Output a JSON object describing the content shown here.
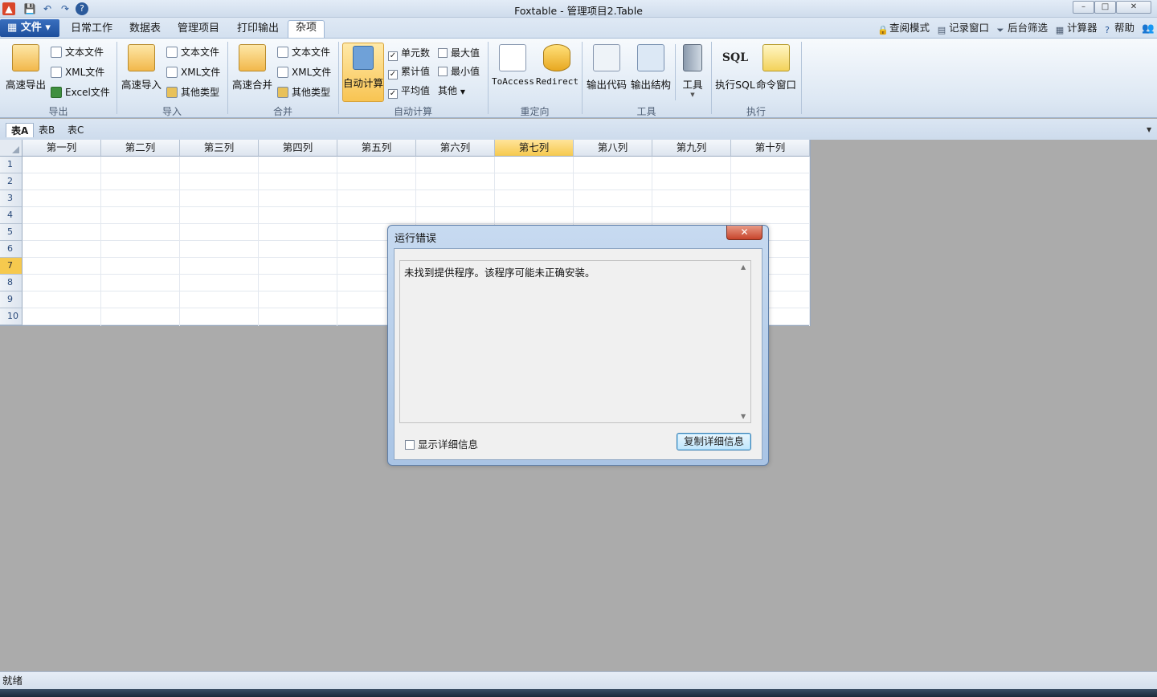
{
  "window": {
    "title": "Foxtable - 管理项目2.Table",
    "minimize": "–",
    "maximize": "□",
    "close": "✕"
  },
  "menu": {
    "file": "文件",
    "tabs": [
      "日常工作",
      "数据表",
      "管理项目",
      "打印输出",
      "杂项"
    ],
    "right_tools": [
      "查阅模式",
      "记录窗口",
      "后台筛选",
      "计算器",
      "帮助"
    ]
  },
  "ribbon": {
    "export": {
      "big": "高速导出",
      "small": [
        "文本文件",
        "XML文件",
        "Excel文件"
      ],
      "label": "导出"
    },
    "import": {
      "big": "高速导入",
      "small": [
        "文本文件",
        "XML文件",
        "其他类型"
      ],
      "label": "导入"
    },
    "merge": {
      "big": "高速合并",
      "small": [
        "文本文件",
        "XML文件",
        "其他类型"
      ],
      "label": "合并"
    },
    "autocalc": {
      "big": "自动计算",
      "checks": [
        {
          "label": "单元数",
          "checked": true
        },
        {
          "label": "最大值",
          "checked": false
        },
        {
          "label": "累计值",
          "checked": true
        },
        {
          "label": "最小值",
          "checked": false
        },
        {
          "label": "平均值",
          "checked": true
        }
      ],
      "other": "其他",
      "label": "自动计算"
    },
    "redirect": {
      "buttons": [
        "ToAccess",
        "Redirect"
      ],
      "label": "重定向"
    },
    "tools": {
      "buttons": [
        "输出代码",
        "输出结构",
        "工具"
      ],
      "label": "工具"
    },
    "execute": {
      "buttons": [
        "执行SQL",
        "命令窗口"
      ],
      "label": "执行"
    }
  },
  "sheets": [
    "表A",
    "表B",
    "表C"
  ],
  "grid": {
    "columns": [
      "第一列",
      "第二列",
      "第三列",
      "第四列",
      "第五列",
      "第六列",
      "第七列",
      "第八列",
      "第九列",
      "第十列"
    ],
    "rows": [
      "1",
      "2",
      "3",
      "4",
      "5",
      "6",
      "7",
      "8",
      "9",
      "10"
    ],
    "selected_column": "第七列",
    "selected_row": "7"
  },
  "dialog": {
    "title": "运行错误",
    "close": "✕",
    "message": "未找到提供程序。该程序可能未正确安装。",
    "detail_checkbox": "显示详细信息",
    "copy_button": "复制详细信息"
  },
  "status": {
    "text": "就绪"
  }
}
